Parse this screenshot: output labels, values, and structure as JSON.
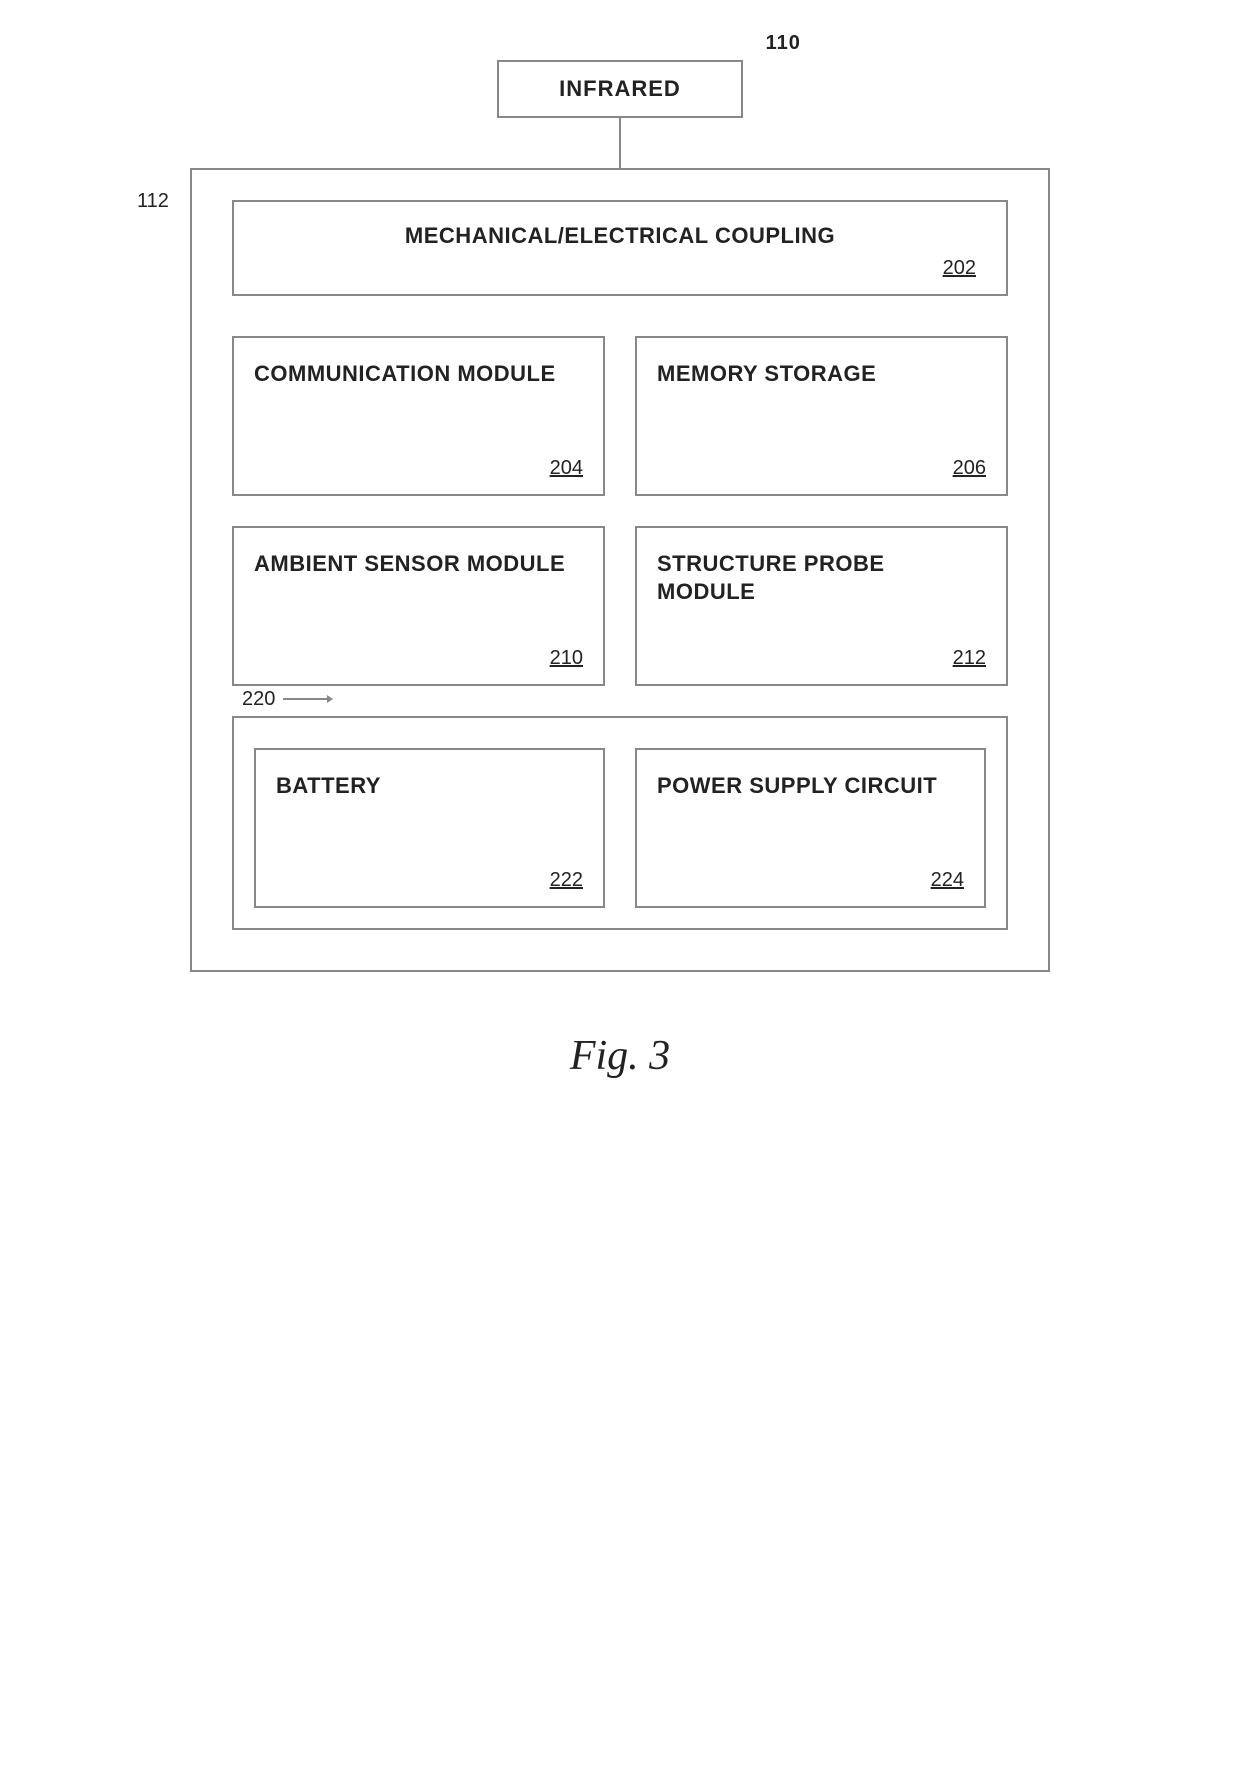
{
  "diagram": {
    "infrared": {
      "label": "INFRARED",
      "ref": "110"
    },
    "outer_box_ref": "112",
    "mec": {
      "label": "MECHANICAL/ELECTRICAL COUPLING",
      "ref": "202"
    },
    "row1": [
      {
        "label": "COMMUNICATION MODULE",
        "ref": "204"
      },
      {
        "label": "MEMORY STORAGE",
        "ref": "206"
      }
    ],
    "row2": [
      {
        "label": "AMBIENT SENSOR MODULE",
        "ref": "210"
      },
      {
        "label": "STRUCTURE PROBE MODULE",
        "ref": "212"
      }
    ],
    "power_section": {
      "ref": "220",
      "boxes": [
        {
          "label": "BATTERY",
          "ref": "222"
        },
        {
          "label": "POWER SUPPLY CIRCUIT",
          "ref": "224"
        }
      ]
    },
    "figure_label": "Fig. 3"
  }
}
